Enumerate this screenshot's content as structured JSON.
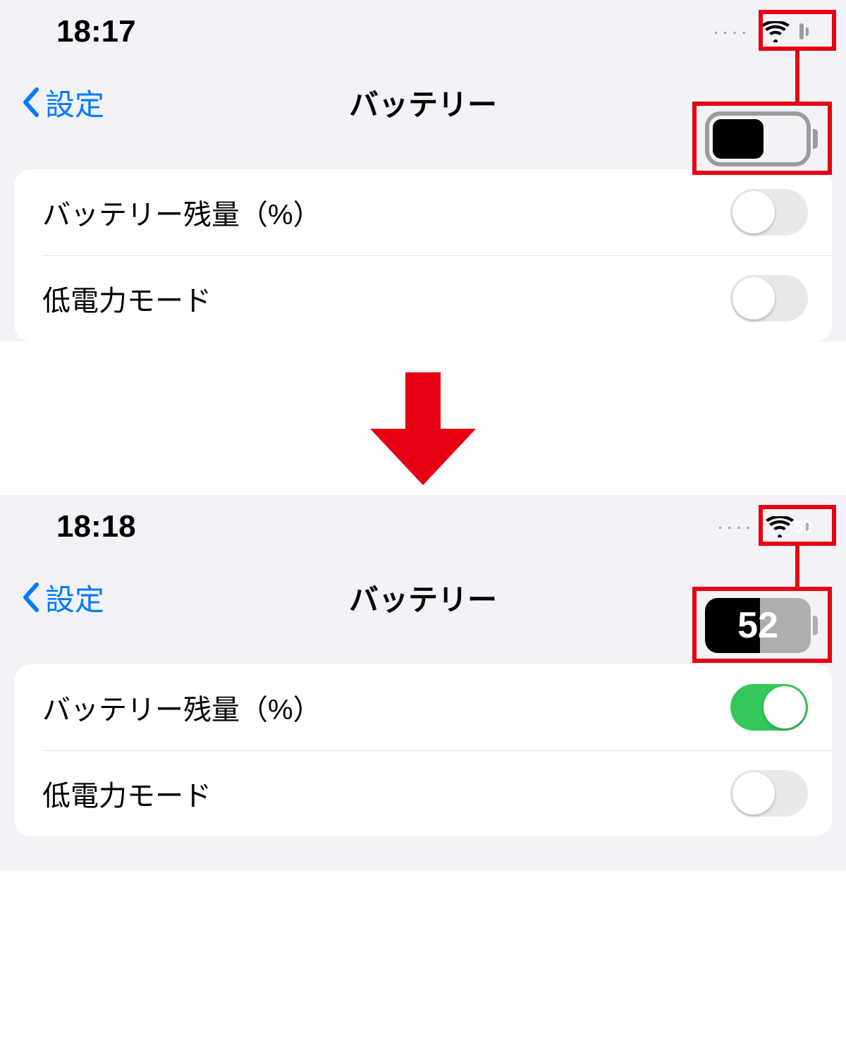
{
  "annotation": {
    "highlight_color": "#e70012"
  },
  "panel1": {
    "status": {
      "time": "18:17",
      "wifi": "wifi-icon",
      "signal_dots": "····",
      "battery_percent_shown": false,
      "battery_level": 52
    },
    "nav": {
      "back_label": "設定",
      "title": "バッテリー"
    },
    "rows": {
      "percent": {
        "label": "バッテリー残量（%）",
        "on": false
      },
      "lowpower": {
        "label": "低電力モード",
        "on": false
      }
    },
    "callout_battery_value": ""
  },
  "panel2": {
    "status": {
      "time": "18:18",
      "wifi": "wifi-icon",
      "signal_dots": "····",
      "battery_percent_shown": true,
      "battery_level": 52,
      "battery_percent_text": "52"
    },
    "nav": {
      "back_label": "設定",
      "title": "バッテリー"
    },
    "rows": {
      "percent": {
        "label": "バッテリー残量（%）",
        "on": true
      },
      "lowpower": {
        "label": "低電力モード",
        "on": false
      }
    },
    "callout_battery_value": "52"
  }
}
